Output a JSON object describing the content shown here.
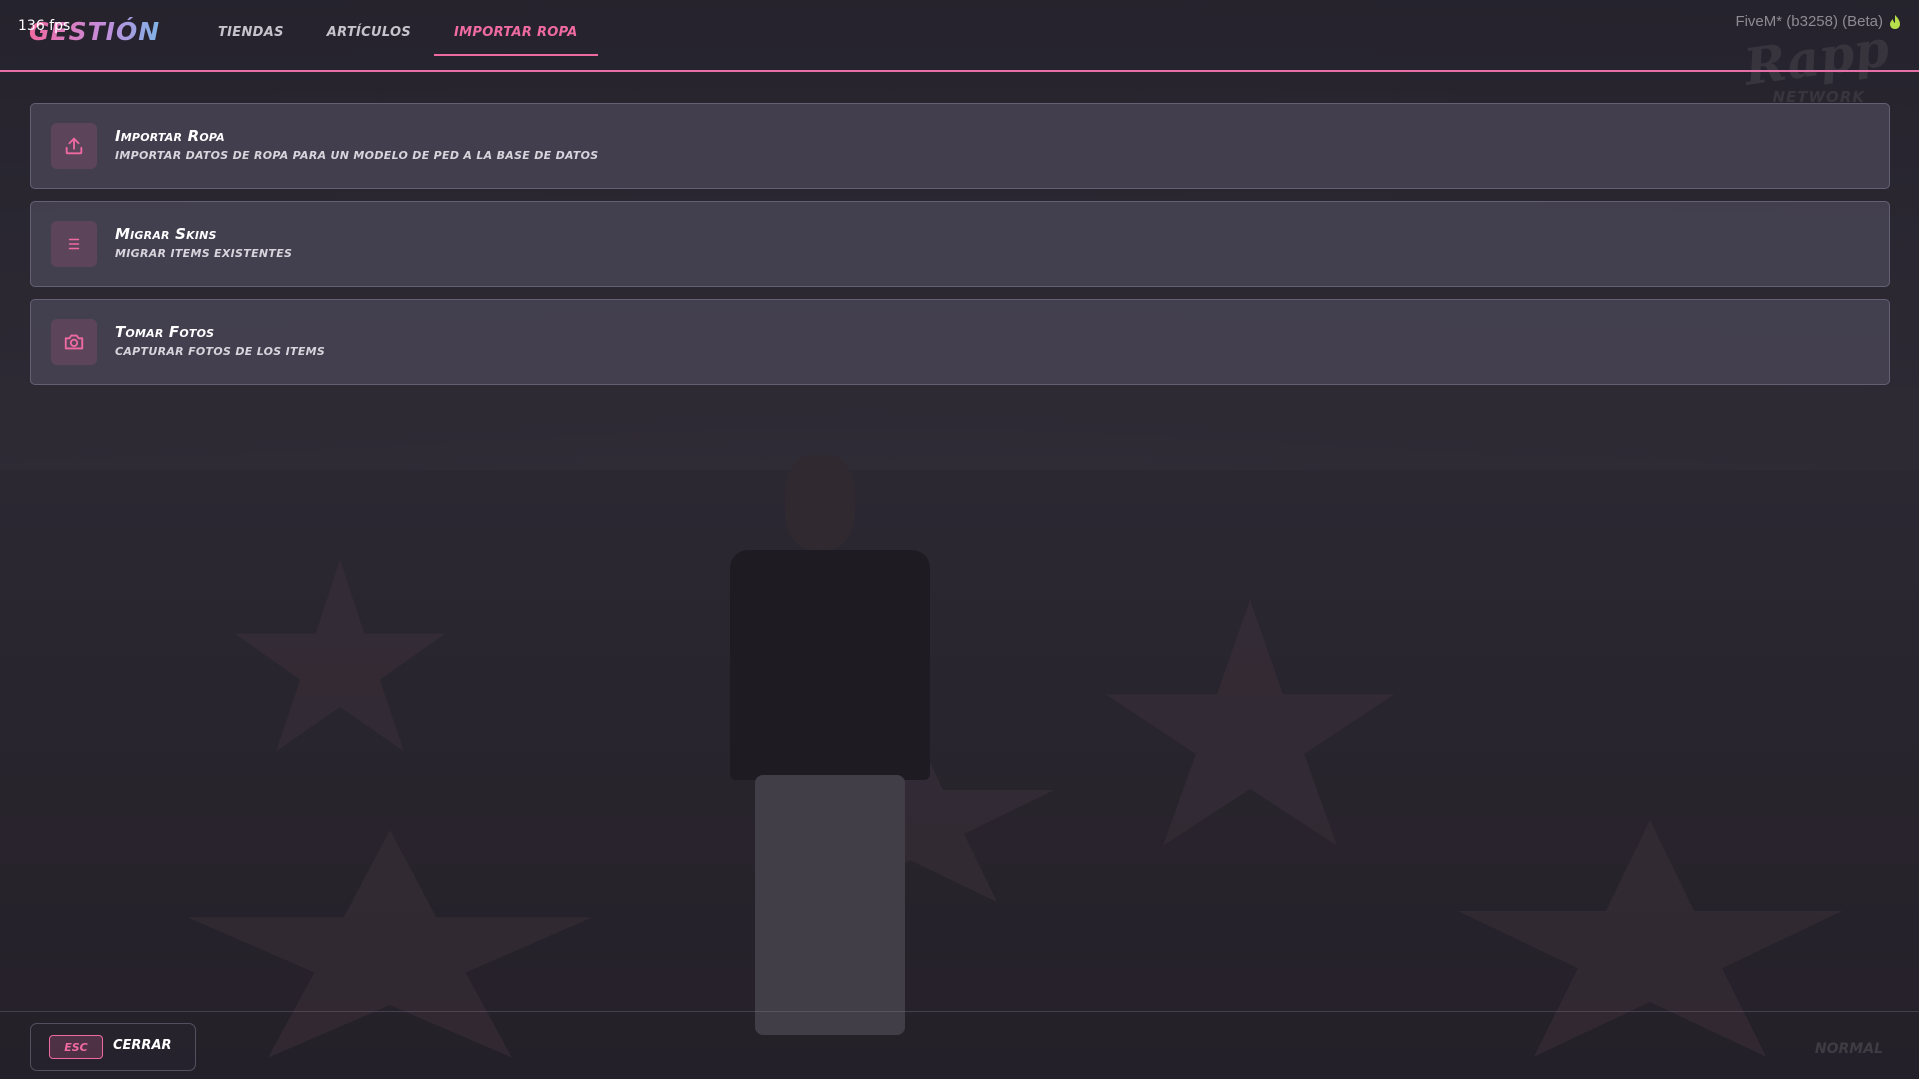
{
  "overlay": {
    "fps": "136 fps",
    "fivem_version": "FiveM* (b3258) (Beta)",
    "watermark": "Rapp",
    "watermark_sub": "NETWORK"
  },
  "header": {
    "logo": "GESTIÓN",
    "tabs": [
      {
        "label": "Tiendas",
        "active": false
      },
      {
        "label": "Artículos",
        "active": false
      },
      {
        "label": "Importar Ropa",
        "active": true
      }
    ]
  },
  "cards": [
    {
      "title": "Importar Ropa",
      "description": "Importar datos de ropa para un modelo de ped a la base de datos",
      "icon": "upload-icon"
    },
    {
      "title": "Migrar Skins",
      "description": "Migrar items existentes",
      "icon": "list-icon"
    },
    {
      "title": "Tomar Fotos",
      "description": "Capturar fotos de los items",
      "icon": "camera-icon"
    }
  ],
  "footer": {
    "key": "ESC",
    "close_label": "Cerrar",
    "mode": "NORMAL"
  },
  "colors": {
    "accent": "#f06aa2",
    "card_bg": "#484456",
    "text": "#ffffff"
  }
}
